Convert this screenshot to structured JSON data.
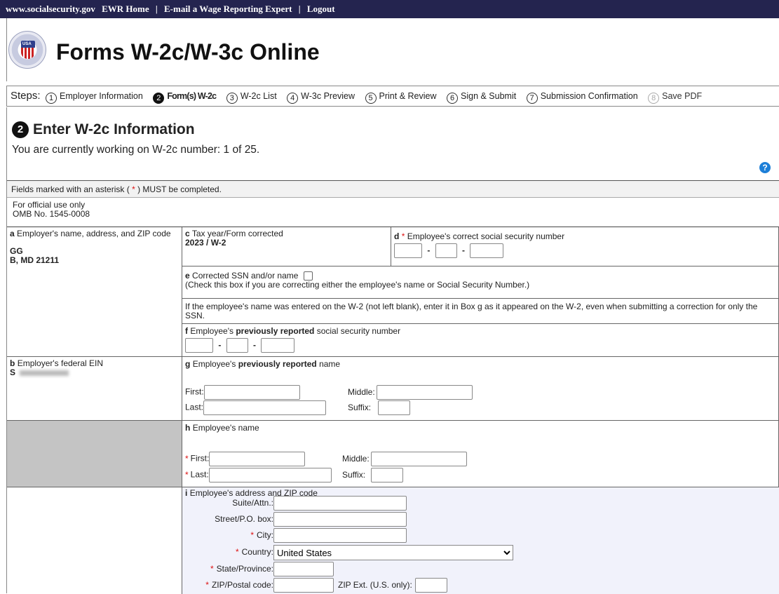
{
  "topbar": {
    "site": "www.socialsecurity.gov",
    "ewr_home": "EWR Home",
    "email_expert": "E-mail a Wage Reporting Expert",
    "logout": "Logout",
    "sep": "|"
  },
  "header": {
    "seal_text": "USA",
    "title": "Forms W-2c/W-3c Online"
  },
  "steps": {
    "label": "Steps:",
    "items": [
      {
        "num": "1",
        "label": "Employer Information"
      },
      {
        "num": "2",
        "label": "Form(s) W-2c"
      },
      {
        "num": "3",
        "label": "W-2c List"
      },
      {
        "num": "4",
        "label": "W-3c Preview"
      },
      {
        "num": "5",
        "label": "Print & Review"
      },
      {
        "num": "6",
        "label": "Sign & Submit"
      },
      {
        "num": "7",
        "label": "Submission Confirmation"
      },
      {
        "num": "8",
        "label": "Save PDF"
      }
    ]
  },
  "main": {
    "step_num": "2",
    "heading": "Enter W-2c Information",
    "working": "You are currently working on W-2c number: 1 of 25.",
    "help": "?"
  },
  "form": {
    "notice_pre": "Fields marked with an asterisk (",
    "asterisk": "*",
    "notice_post": ") MUST be completed.",
    "official_1": "For official use only",
    "official_2": "OMB No. 1545-0008",
    "a_letter": "a",
    "a_label": "Employer's name, address, and ZIP code",
    "a_name": "GG",
    "a_addr": "B, MD 21211",
    "b_letter": "b",
    "b_label": "Employer's federal EIN",
    "b_value": "S",
    "c_letter": "c",
    "c_label": "Tax year/Form corrected",
    "c_value": "2023 / W-2",
    "d_letter": "d",
    "d_label": "Employee's correct social security number",
    "e_letter": "e",
    "e_label": "Corrected SSN and/or name",
    "e_note": "(Check this box if you are correcting either the employee's name or Social Security Number.)",
    "name_note": "If the employee's name was entered on the W-2 (not left blank), enter it in Box g as it appeared on the W-2, even when submitting a correction for only the SSN.",
    "f_letter": "f",
    "f_pre": "Employee's",
    "f_bold": "previously reported",
    "f_post": "social security number",
    "g_letter": "g",
    "g_pre": "Employee's",
    "g_bold": "previously reported",
    "g_post": "name",
    "h_letter": "h",
    "h_label": "Employee's name",
    "i_letter": "i",
    "i_label": "Employee's address and ZIP code",
    "first": "First:",
    "middle": "Middle:",
    "last": "Last:",
    "suffix": "Suffix:",
    "dash": "-",
    "suite": "Suite/Attn.:",
    "street": "Street/P.O. box:",
    "city": "City:",
    "country": "Country:",
    "country_value": "United States",
    "state": "State/Province:",
    "zip": "ZIP/Postal code:",
    "zip_ext": "ZIP Ext. (U.S. only):"
  }
}
